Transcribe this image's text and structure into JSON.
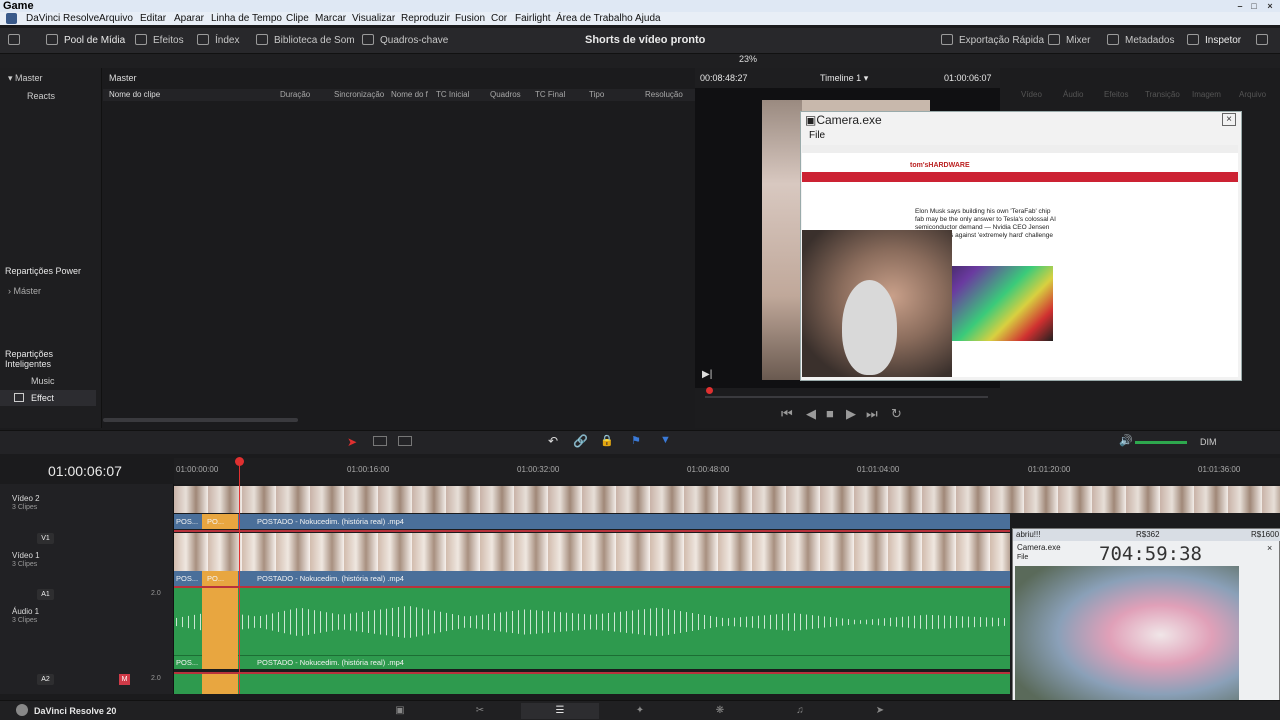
{
  "window": {
    "title": "Game"
  },
  "menu": [
    "DaVinci Resolve",
    "Arquivo",
    "Editar",
    "Aparar",
    "Linha de Tempo",
    "Clipe",
    "Marcar",
    "Visualizar",
    "Reproduzir",
    "Fusion",
    "Cor",
    "Fairlight",
    "Área de Trabalho",
    "Ajuda"
  ],
  "toolbar": {
    "media_pool": "Pool de Mídia",
    "effects": "Efeitos",
    "index": "Índex",
    "sound_library": "Biblioteca de Som",
    "keyframes": "Quadros-chave",
    "project_title": "Shorts de vídeo pronto",
    "quick_export": "Exportação Rápida",
    "mixer": "Mixer",
    "metadata": "Metadados",
    "inspector": "Inspetor"
  },
  "pool": {
    "zoom": "23%",
    "bin_master": "Master",
    "bin_reacts": "Reacts",
    "title": "Master",
    "columns": [
      "Nome do clipe",
      "Duração",
      "Sincronização",
      "Nome do f",
      "TC Inicial",
      "Quadros",
      "TC Final",
      "Tipo",
      "Resolução"
    ],
    "power_bins": "Repartições Power",
    "power_master": "Máster",
    "smart_bins": "Repartições Inteligentes",
    "smart_items": [
      "Music",
      "Effect"
    ]
  },
  "viewer": {
    "timecode_left": "00:08:48:27",
    "timeline_name": "Timeline 1",
    "timecode_right": "01:00:06:07"
  },
  "inspector_tabs": [
    "Vídeo",
    "Áudio",
    "Efeitos",
    "Transição",
    "Imagem",
    "Arquivo"
  ],
  "camera_window": {
    "title": "Camera.exe",
    "menu_file": "File",
    "site_logo": "tom'sHARDWARE",
    "article_title": "Elon Musk says building his own 'TeraFab' chip fab may be the only answer to Tesla's colossal AI semiconductor demand — Nvidia CEO Jensen Huang warns against 'extremely hard' challenge"
  },
  "timeline": {
    "timecode": "01:00:06:07",
    "ruler": [
      "01:00:00:00",
      "01:00:16:00",
      "01:00:32:00",
      "01:00:48:00",
      "01:01:04:00",
      "01:01:20:00",
      "01:01:36:00"
    ],
    "tracks": [
      {
        "name": "Vídeo 2",
        "sub": "3 Clipes"
      },
      {
        "tag": "V1",
        "name": "Vídeo 1",
        "sub": "3 Clipes"
      },
      {
        "tag": "A1",
        "name": "Áudio 1",
        "sub": "3 Clipes",
        "ch": "2.0"
      },
      {
        "tag": "A2",
        "ch": "2.0"
      }
    ],
    "clip_label": "POSTADO - Nokucedim. (história real) .mp4",
    "clip_short_a": "POS...",
    "clip_short_b": "PO..."
  },
  "overlay": {
    "label_left": "abriu!!!",
    "label_mid": "R$362",
    "label_right": "R$1600",
    "cam_title": "Camera.exe",
    "file": "File",
    "clock": "704:59:38"
  },
  "footer": {
    "app": "DaVinci Resolve 20"
  },
  "colors": {
    "audio": "#2e9a4e",
    "video": "#4a6f9a",
    "playhead": "#e03030",
    "selected_clip": "#e8a640"
  }
}
